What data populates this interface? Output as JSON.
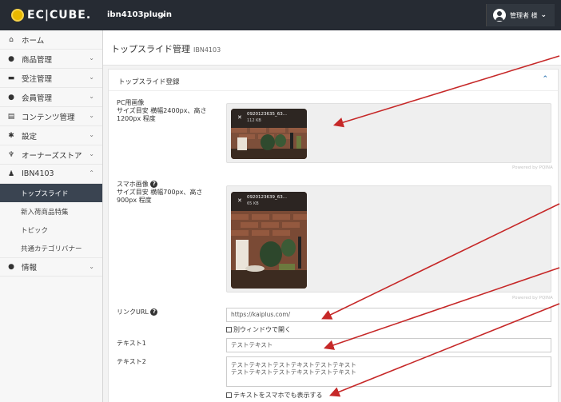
{
  "header": {
    "logo_text": "EC|CUBE.",
    "shop_name": "ibn4103plugin",
    "shop_chevron": "›",
    "user_name": "管理者 様",
    "user_chevron": "⌄"
  },
  "sidebar": {
    "items": [
      {
        "label": "ホーム",
        "icon": "⌂",
        "chevron": ""
      },
      {
        "label": "商品管理",
        "icon": "●",
        "chevron": "⌄"
      },
      {
        "label": "受注管理",
        "icon": "▬",
        "chevron": "⌄"
      },
      {
        "label": "会員管理",
        "icon": "●",
        "chevron": "⌄"
      },
      {
        "label": "コンテンツ管理",
        "icon": "▤",
        "chevron": "⌄"
      },
      {
        "label": "設定",
        "icon": "✱",
        "chevron": "⌄"
      },
      {
        "label": "オーナーズストア",
        "icon": "♆",
        "chevron": "⌄"
      },
      {
        "label": "IBN4103",
        "icon": "♟",
        "chevron": "⌃"
      }
    ],
    "sub_items": [
      {
        "label": "トップスライド"
      },
      {
        "label": "新入荷商品特集"
      },
      {
        "label": "トピック"
      },
      {
        "label": "共通カテゴリバナー"
      }
    ],
    "info_item": {
      "label": "情報",
      "icon": "●",
      "chevron": "⌄"
    }
  },
  "page": {
    "title": "トップスライド管理",
    "subtitle": "IBN4103"
  },
  "panel": {
    "title": "トップスライド登録",
    "toggle": "⌃"
  },
  "form": {
    "pc_image": {
      "label": "PC用画像",
      "hint": "サイズ目安 横幅2400px、高さ1200px 程度",
      "file_name": "0920123635_63...",
      "file_size": "112 KB",
      "powered": "Powered by PQINA"
    },
    "sp_image": {
      "label": "スマホ画像",
      "hint": "サイズ目安 横幅700px、高さ900px 程度",
      "file_name": "0920123639_63...",
      "file_size": "65 KB",
      "powered": "Powered by PQINA"
    },
    "link_url": {
      "label": "リンクURL",
      "value": "https://kaiplus.com/"
    },
    "new_window": {
      "label": "別ウィンドウで開く"
    },
    "text1": {
      "label": "テキスト1",
      "value": "テストテキスト"
    },
    "text2": {
      "label": "テキスト2",
      "value": "テストテキストテストテキストテストテキスト\nテストテキストテストテキストテストテキスト"
    },
    "sp_display": {
      "label": "テキストをスマホでも表示する"
    }
  },
  "colors": {
    "header_bg": "#262b33",
    "active_item_bg": "#3a4451",
    "accent_blue": "#3379b5",
    "annotation_red": "#c62828"
  }
}
